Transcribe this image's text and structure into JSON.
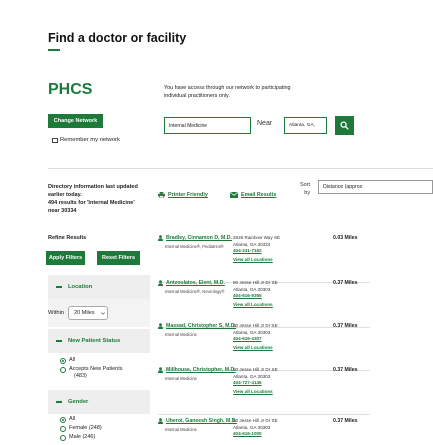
{
  "page": {
    "title": "Find a doctor or facility"
  },
  "network": {
    "logo": "PHCS",
    "access_text": "You have access through our network to participating individual practitioners only.",
    "change_button": "Change Network",
    "remember_label": "Remember my network"
  },
  "search": {
    "query_value": "Internal Medicine",
    "near_label": "Near",
    "near_value": "Atlanta, GA,"
  },
  "directory": {
    "info_line1": "Directory information last updated",
    "info_line2": "earlier today.",
    "results_line1": "494 results for 'Internal Medicine'",
    "results_line2": "near 30334"
  },
  "toolbar": {
    "printer_friendly": "Printer Friendly",
    "email_results": "Email Results",
    "sort_label_1": "Sort",
    "sort_label_2": "by",
    "sort_value": "Distance (approx"
  },
  "filters": {
    "refine_title": "Refine Results",
    "apply_label": "Apply Filters",
    "reset_label": "Reset Filters",
    "location": {
      "title": "Location",
      "within_label": "Within",
      "within_value": "20 Miles"
    },
    "new_patient": {
      "title": "New Patient Status",
      "options": [
        "All",
        "Accepts New Patients",
        "(483)"
      ]
    },
    "gender": {
      "title": "Gender",
      "options": [
        "All",
        "Female (248)",
        "Male (246)"
      ]
    }
  },
  "results": [
    {
      "name": "Bradley, Cinnamon D, M.D.",
      "specialties": "Internal Medicine®, Pediatrics®",
      "address1": "2626 Rainbow Way SE",
      "address2": "Atlanta, GA 30334",
      "phone": "404-241-7162",
      "locations": "View all Locations",
      "distance": "0.03 Miles"
    },
    {
      "name": "Antzoulatos, Eleni, M.D.",
      "specialties": "Internal Medicine®, Neurology®",
      "address1": "80 Jesse Hill Jr Dr SE",
      "address2": "Atlanta, GA 30303",
      "phone": "404-616-9355",
      "locations": "View all Locations",
      "distance": "0.37 Miles"
    },
    {
      "name": "Massad, Christopher S, M.D.",
      "specialties": "Internal Medicine",
      "address1": "80 Jesse Hill Jr Dr SE",
      "address2": "Atlanta, GA 30303",
      "phone": "404-616-4307",
      "locations": "View all Locations",
      "distance": "0.37 Miles"
    },
    {
      "name": "Millhouse, Christopher, M.D.",
      "specialties": "Internal Medicine",
      "address1": "80 Jesse Hill Jr Dr SE",
      "address2": "Atlanta, GA 30303",
      "phone": "404-727-4145",
      "locations": "View all Locations",
      "distance": "0.37 Miles"
    },
    {
      "name": "Uberoi, Ganeesh Singh, M.D.",
      "specialties": "Internal Medicine",
      "address1": "80 Jesse Hill Jr Dr SE",
      "address2": "Atlanta, GA 30303",
      "phone": "404-616-1000",
      "locations": "",
      "distance": "0.37 Miles"
    }
  ],
  "icons": {
    "search": "search-icon",
    "printer": "printer-icon",
    "email": "email-icon",
    "person": "person-icon",
    "chevron": "chevron-down-icon"
  },
  "colors": {
    "brand_green": "#1d7a3a",
    "facet_bg": "#eeeeee"
  }
}
